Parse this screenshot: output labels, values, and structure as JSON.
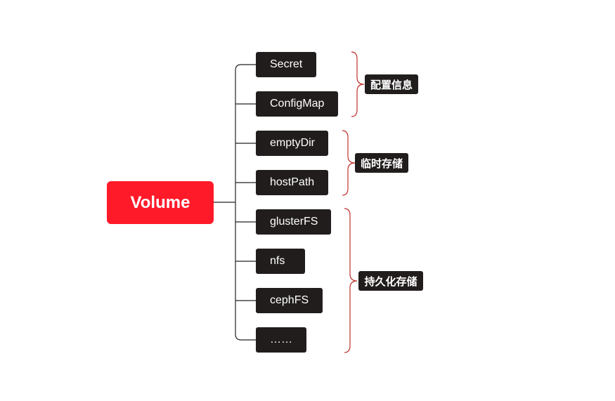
{
  "root": {
    "label": "Volume",
    "color": "#ff1a2a"
  },
  "leaves": [
    {
      "label": "Secret"
    },
    {
      "label": "ConfigMap"
    },
    {
      "label": "emptyDir"
    },
    {
      "label": "hostPath"
    },
    {
      "label": "glusterFS"
    },
    {
      "label": "nfs"
    },
    {
      "label": "cephFS"
    },
    {
      "label": "……"
    }
  ],
  "groups": [
    {
      "label": "配置信息"
    },
    {
      "label": "临时存储"
    },
    {
      "label": "持久化存储"
    }
  ],
  "colors": {
    "node_fill": "#221d1d",
    "connector": "#222222",
    "brace": "#c0302a"
  }
}
